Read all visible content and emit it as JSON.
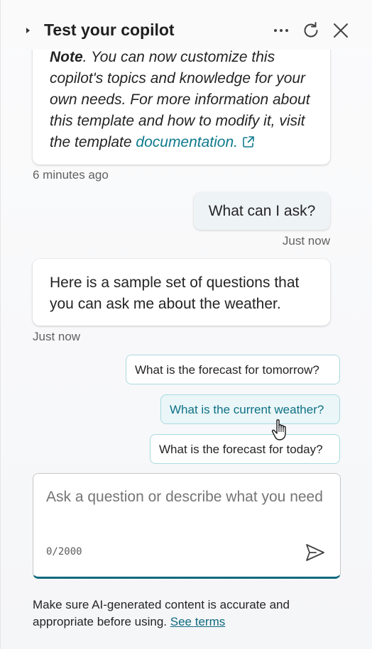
{
  "header": {
    "title": "Test your copilot",
    "icons": [
      "caret-right-icon",
      "more-icon",
      "refresh-icon",
      "close-icon"
    ]
  },
  "messages": {
    "bot_1": {
      "note_label": "Note",
      "text_part1": ". You can now customize this copilot's topics and knowledge for your own needs. For more information about this template and how to modify it, visit the template ",
      "link_text": "documentation.",
      "timestamp": "6 minutes ago"
    },
    "user_1": {
      "text": "What can I ask?",
      "timestamp": "Just now"
    },
    "bot_2": {
      "text": "Here is a sample set of questions that you can ask me about the weather.",
      "timestamp": "Just now"
    }
  },
  "suggestions": [
    "What is the forecast for tomorrow?",
    "What is the current weather?",
    "What is the forecast for today?"
  ],
  "input": {
    "placeholder": "Ask a question or describe what you need",
    "char_count": "0/2000"
  },
  "footer": {
    "disclaimer": "Make sure AI-generated content is accurate and appropriate before using.",
    "link": "See terms"
  },
  "colors": {
    "accent": "#0e6a7e",
    "suggestion_border": "#a9dbe0",
    "link": "#0e7a8c"
  }
}
